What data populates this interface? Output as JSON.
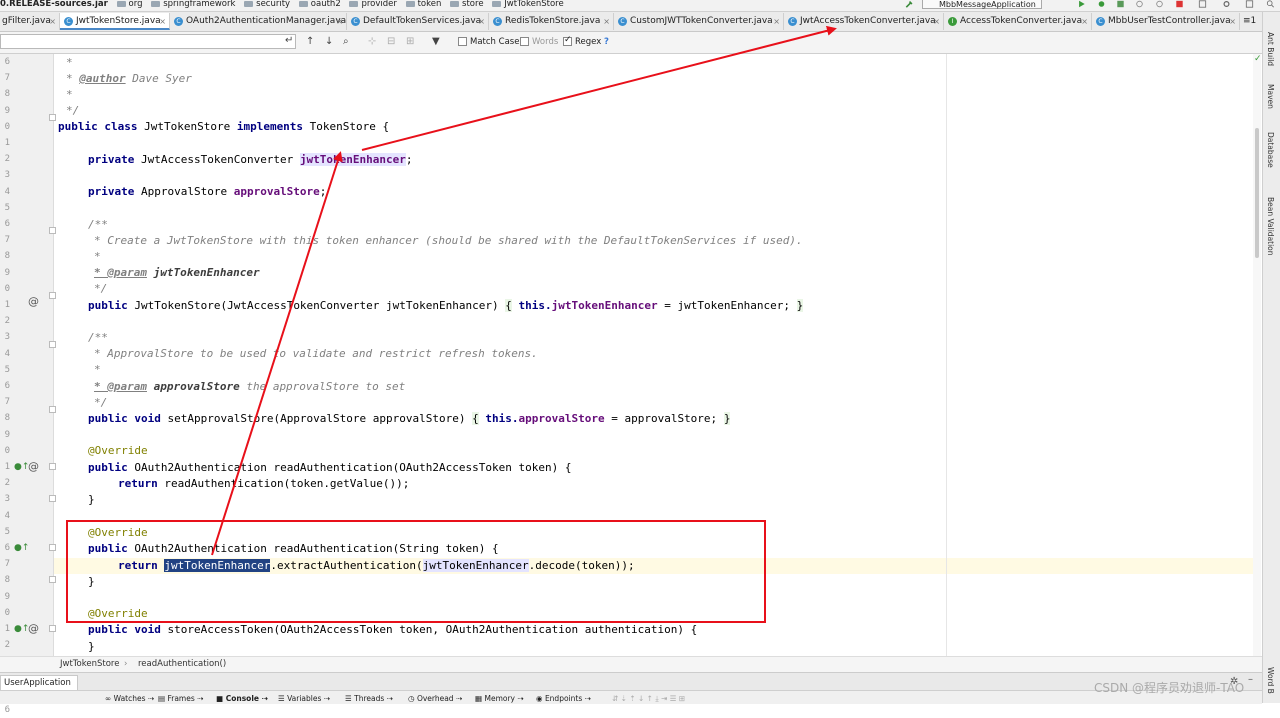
{
  "navbar": {
    "crumbs": [
      "0.RELEASE-sources.jar",
      "org",
      "springframework",
      "security",
      "oauth2",
      "provider",
      "token",
      "store",
      "JwtTokenStore"
    ],
    "run_config": "MbbMessageApplication"
  },
  "tabs": [
    {
      "label": "gFilter.java",
      "active": false
    },
    {
      "label": "JwtTokenStore.java",
      "active": true
    },
    {
      "label": "OAuth2AuthenticationManager.java",
      "active": false
    },
    {
      "label": "DefaultTokenServices.java",
      "active": false
    },
    {
      "label": "RedisTokenStore.java",
      "active": false
    },
    {
      "label": "CustomJWTTokenConverter.java",
      "active": false
    },
    {
      "label": "JwtAccessTokenConverter.java",
      "active": false
    },
    {
      "label": "AccessTokenConverter.java",
      "active": false
    },
    {
      "label": "MbbUserTestController.java",
      "active": false
    }
  ],
  "tab_overflow": "≡1",
  "search": {
    "value": "",
    "match_case": "Match Case",
    "words": "Words",
    "regex": "Regex",
    "regex_checked": true,
    "help": "?"
  },
  "gutter": {
    "line_numbers": [
      "6",
      "7",
      "8",
      "9",
      "0",
      "1",
      "2",
      "3",
      "4",
      "5",
      "6",
      "7",
      "8",
      "9",
      "0",
      "1",
      "2",
      "3",
      "4",
      "5",
      "6",
      "7",
      "8",
      "9",
      "0",
      "1",
      "2",
      "3",
      "4",
      "5",
      "6",
      "7",
      "8",
      "9",
      "0",
      "1",
      "2",
      "3",
      "4",
      "5",
      "6"
    ],
    "override_mark": "@"
  },
  "code": {
    "line1": "*",
    "line2_tag": "@author",
    "line2_text": " Dave Syer",
    "line3": "*",
    "line4": "*/",
    "class_decl": {
      "kw1": "public class",
      "name": " JwtTokenStore ",
      "kw2": "implements",
      "rest": " TokenStore {"
    },
    "field1": {
      "kw": "private",
      "type": " JwtAccessTokenConverter ",
      "name": "jwtTokenEnhancer",
      "end": ";"
    },
    "field2": {
      "kw": "private",
      "type": " ApprovalStore ",
      "name": "approvalStore",
      "end": ";"
    },
    "doc1_open": "/**",
    "doc1_text": "* Create a JwtTokenStore with this token enhancer (should be shared with the DefaultTokenServices if used).",
    "doc1_star": "*",
    "doc1_param_tag": "* @param",
    "doc1_param_name": " jwtTokenEnhancer",
    "doc1_close": "*/",
    "ctor": {
      "kw": "public",
      "sig": " JwtTokenStore(JwtAccessTokenConverter jwtTokenEnhancer) ",
      "ob": "{",
      "this": " this.",
      "field": "jwtTokenEnhancer",
      "rest": " = jwtTokenEnhancer; ",
      "cb": "}"
    },
    "doc2_open": "/**",
    "doc2_text": "* ApprovalStore to be used to validate and restrict refresh tokens.",
    "doc2_star": "*",
    "doc2_param_tag": "* @param",
    "doc2_param_name": " approvalStore",
    "doc2_param_desc": " the approvalStore to set",
    "doc2_close": "*/",
    "setter": {
      "kw": "public void",
      "sig": " setApprovalStore(ApprovalStore approvalStore) ",
      "ob": "{",
      "this": " this.",
      "field": "approvalStore",
      "rest": " = approvalStore; ",
      "cb": "}"
    },
    "ann1": "@Override",
    "m1_sig": {
      "kw": "public",
      "rest": " OAuth2Authentication readAuthentication(OAuth2AccessToken token) {"
    },
    "m1_body": {
      "kw": "return",
      "rest": " readAuthentication(token.getValue());"
    },
    "close1": "}",
    "ann2": "@Override",
    "m2_sig": {
      "kw": "public",
      "rest": " OAuth2Authentication readAuthentication(String token) {"
    },
    "m2_body": {
      "kw": "return",
      "sel": "jwtTokenEnhancer",
      "mid": ".extractAuthentication(",
      "hl": "jwtTokenEnhancer",
      "end": ".decode(token));"
    },
    "close2": "}",
    "ann3": "@Override",
    "m3_sig": {
      "kw": "public void",
      "rest": " storeAccessToken(OAuth2AccessToken token, OAuth2Authentication authentication) {"
    },
    "close3": "}"
  },
  "editor_breadcrumb": {
    "cls": "JwtTokenStore",
    "method": "readAuthentication()"
  },
  "run_tab": "UserApplication",
  "debug_tabs": [
    "Watches",
    "Frames",
    "Console",
    "Variables",
    "Threads",
    "Overhead",
    "Memory",
    "Endpoints"
  ],
  "right_tabs": [
    "Ant Build",
    "Maven",
    "Database",
    "Bean Validation",
    "Word B"
  ],
  "watermark": "CSDN @程序员劝退师-TAO",
  "colors": {
    "annotation": "#e8101a",
    "selection": "#214283"
  }
}
